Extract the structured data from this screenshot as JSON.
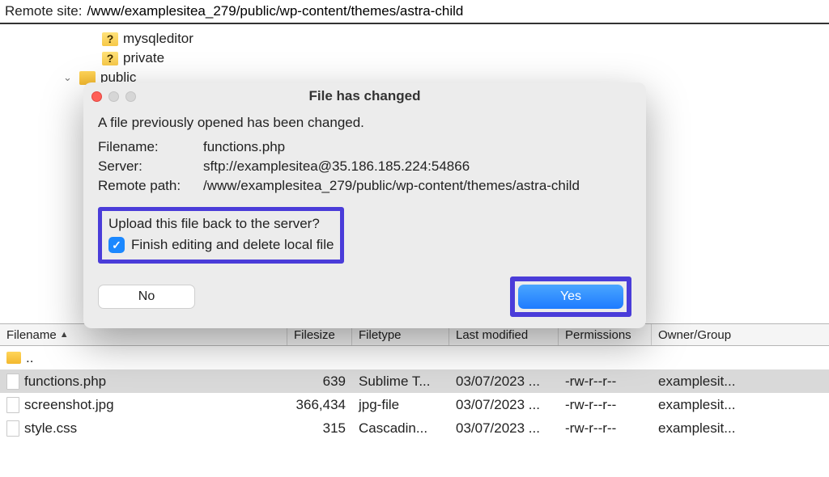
{
  "remote_bar": {
    "label": "Remote site:",
    "path": "/www/examplesitea_279/public/wp-content/themes/astra-child"
  },
  "tree": {
    "items": [
      {
        "icon": "folder-q",
        "label": "mysqleditor",
        "expander": ""
      },
      {
        "icon": "folder-q",
        "label": "private",
        "expander": ""
      },
      {
        "icon": "folder",
        "label": "public",
        "expander": "⌄"
      }
    ]
  },
  "columns": {
    "name": "Filename",
    "size": "Filesize",
    "type": "Filetype",
    "modified": "Last modified",
    "permissions": "Permissions",
    "owner": "Owner/Group"
  },
  "parent_dir": "..",
  "files": [
    {
      "name": "functions.php",
      "size": "639",
      "type": "Sublime T...",
      "modified": "03/07/2023 ...",
      "perm": "-rw-r--r--",
      "owner": "examplesit...",
      "selected": true
    },
    {
      "name": "screenshot.jpg",
      "size": "366,434",
      "type": "jpg-file",
      "modified": "03/07/2023 ...",
      "perm": "-rw-r--r--",
      "owner": "examplesit...",
      "selected": false
    },
    {
      "name": "style.css",
      "size": "315",
      "type": "Cascadin...",
      "modified": "03/07/2023 ...",
      "perm": "-rw-r--r--",
      "owner": "examplesit...",
      "selected": false
    }
  ],
  "dialog": {
    "title": "File has changed",
    "message": "A file previously opened has been changed.",
    "labels": {
      "filename": "Filename:",
      "server": "Server:",
      "remote_path": "Remote path:"
    },
    "filename": "functions.php",
    "server": "sftp://examplesitea@35.186.185.224:54866",
    "remote_path": "/www/examplesitea_279/public/wp-content/themes/astra-child",
    "upload_question": "Upload this file back to the server?",
    "finish_label": "Finish editing and delete local file",
    "finish_checked": true,
    "no_label": "No",
    "yes_label": "Yes"
  }
}
